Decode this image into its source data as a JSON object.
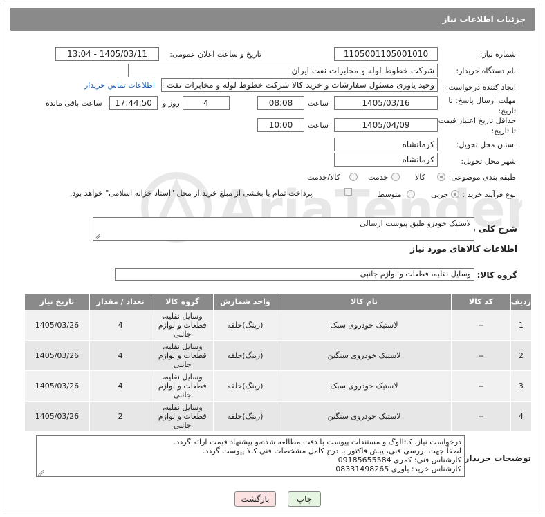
{
  "header": {
    "title": "جزئیات اطلاعات نیاز"
  },
  "fields": {
    "need_number_label": "شماره نیاز:",
    "need_number": "1105001105001010",
    "announce_label": "تاریخ و ساعت اعلان عمومی:",
    "announce_value": "1405/03/11 - 13:04",
    "buyer_label": "نام دستگاه خریدار:",
    "buyer_value": "شرکت خطوط لوله و مخابرات نفت ایران",
    "creator_label": "ایجاد کننده درخواست:",
    "creator_value": "وحید یاوری مسئول سفارشات و خرید کالا  شرکت خطوط لوله و مخابرات نفت ایرا",
    "contact_link": "اطلاعات تماس خریدار",
    "reply_label": "مهلت ارسال پاسخ: تا تاریخ:",
    "reply_date": "1405/03/16",
    "time_label": "ساعت",
    "reply_time": "08:08",
    "days_value": "4",
    "days_label": "روز و",
    "remaining_time": "17:44:50",
    "remaining_label": "ساعت باقی مانده",
    "validity_label": "حداقل تاریخ اعتبار قیمت: تا تاریخ:",
    "validity_date": "1405/04/09",
    "validity_time": "10:00",
    "province_label": "استان محل تحویل:",
    "province_value": "کرمانشاه",
    "city_label": "شهر محل تحویل:",
    "city_value": "کرمانشاه",
    "category_label": "طبقه بندی موضوعی:",
    "cat_goods": "کالا",
    "cat_service": "خدمت",
    "cat_both": "کالا/خدمت",
    "process_label": "نوع فرآیند خرید :",
    "proc_partial": "جزیی",
    "proc_medium": "متوسط",
    "payment_note": "پرداخت تمام یا بخشی از مبلغ خرید،از محل \"اسناد خزانه اسلامی\" خواهد بود."
  },
  "summary": {
    "label": "شرح کلی نیاز:",
    "value": "لاستیک خودرو طبق پیوست ارسالی"
  },
  "goods_section": {
    "title": "اطلاعات کالاهای مورد نیاز",
    "group_label": "گروه کالا:",
    "group_value": "وسایل نقلیه، قطعات و لوازم جانبی"
  },
  "table": {
    "headers": [
      "ردیف",
      "کد کالا",
      "نام کالا",
      "واحد شمارش",
      "گروه کالا",
      "تعداد / مقدار",
      "تاریخ نیاز"
    ],
    "rows": [
      {
        "row": "1",
        "code": "--",
        "name": "لاستیک خودروی سبک",
        "unit": "(رینگ)حلقه",
        "group": "وسایل نقلیه، قطعات و لوازم جانبی",
        "qty": "4",
        "date": "1405/03/26"
      },
      {
        "row": "2",
        "code": "--",
        "name": "لاستیک خودروی سنگین",
        "unit": "(رینگ)حلقه",
        "group": "وسایل نقلیه، قطعات و لوازم جانبی",
        "qty": "4",
        "date": "1405/03/26"
      },
      {
        "row": "3",
        "code": "--",
        "name": "لاستیک خودروی سبک",
        "unit": "(رینگ)حلقه",
        "group": "وسایل نقلیه، قطعات و لوازم جانبی",
        "qty": "4",
        "date": "1405/03/26"
      },
      {
        "row": "4",
        "code": "--",
        "name": "لاستیک خودروی سنگین",
        "unit": "(رینگ)حلقه",
        "group": "وسایل نقلیه، قطعات و لوازم جانبی",
        "qty": "2",
        "date": "1405/03/26"
      }
    ]
  },
  "buyer_notes": {
    "label": "توضیحات خریدار:",
    "lines": [
      "درخواست نیاز، کاتالوگ و مستندات پیوست با دقت مطالعه شده،و پیشنهاد قیمت ارائه گردد.",
      "لطفاً جهت بررسی فنی، پیش فاکتور با درج کامل مشخصات فنی کالا  پیوست گردد.",
      "کارشناس فنی: کمری 09185655584",
      "کارشناس خرید: یاوری 08331498265"
    ]
  },
  "buttons": {
    "print": "چاپ",
    "back": "بازگشت"
  },
  "watermark": {
    "text": "AriaTender.neT"
  },
  "colors": {
    "header_bg": "#8a8a8a",
    "link": "#1a5fb4",
    "print_bg": "#e6f5e1",
    "back_bg": "#fbe3e3"
  }
}
